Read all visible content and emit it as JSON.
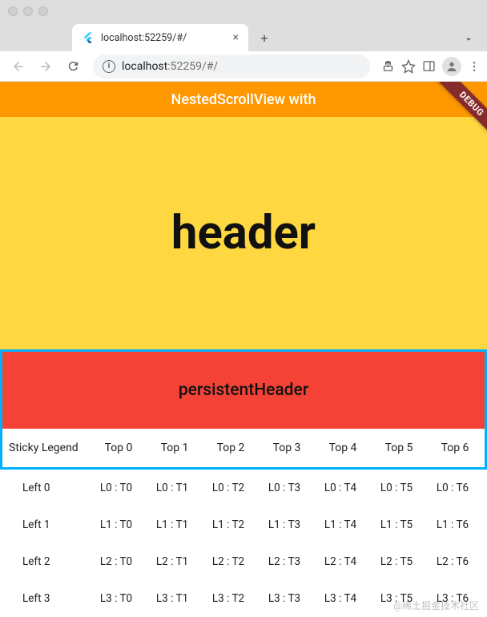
{
  "browser": {
    "tab_title": "localhost:52259/#/",
    "url_host": "localhost",
    "url_rest": ":52259/#/"
  },
  "appbar": {
    "title": "NestedScrollView with"
  },
  "debug_label": "DEBUG",
  "header": {
    "text": "header"
  },
  "persistent": {
    "text": "persistentHeader"
  },
  "legend": {
    "sticky": "Sticky Legend",
    "cols": [
      "Top 0",
      "Top 1",
      "Top 2",
      "Top 3",
      "Top 4",
      "Top 5",
      "Top 6"
    ]
  },
  "rows": [
    {
      "label": "Left 0",
      "cells": [
        "L0 : T0",
        "L0 : T1",
        "L0 : T2",
        "L0 : T3",
        "L0 : T4",
        "L0 : T5",
        "L0 : T6"
      ]
    },
    {
      "label": "Left 1",
      "cells": [
        "L1 : T0",
        "L1 : T1",
        "L1 : T2",
        "L1 : T3",
        "L1 : T4",
        "L1 : T5",
        "L1 : T6"
      ]
    },
    {
      "label": "Left 2",
      "cells": [
        "L2 : T0",
        "L2 : T1",
        "L2 : T2",
        "L2 : T3",
        "L2 : T4",
        "L2 : T5",
        "L2 : T6"
      ]
    },
    {
      "label": "Left 3",
      "cells": [
        "L3 : T0",
        "L3 : T1",
        "L3 : T2",
        "L3 : T3",
        "L3 : T4",
        "L3 : T5",
        "L3 : T6"
      ]
    }
  ],
  "watermark": "@稀土掘金技术社区"
}
